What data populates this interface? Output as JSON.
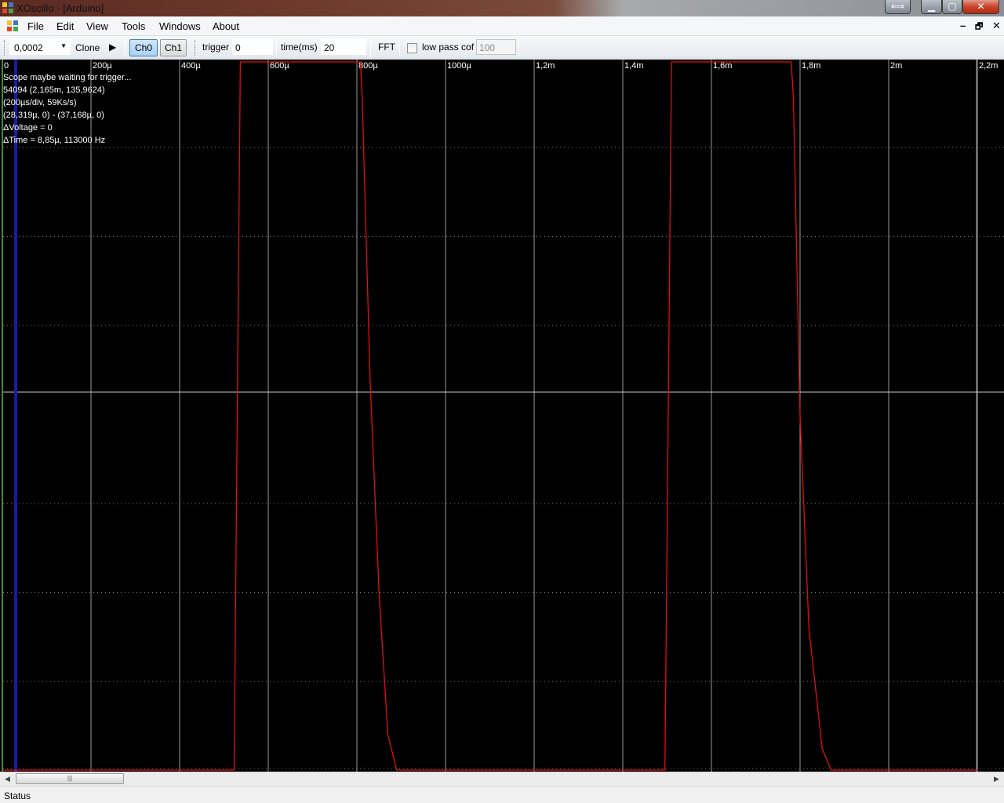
{
  "window": {
    "title": "XOscillo - [Arduino]",
    "close_glyph": "✕",
    "min_glyph": "▁",
    "max_glyph": "▢",
    "swap_glyph": "⟺"
  },
  "menu": {
    "items": [
      {
        "label": "File"
      },
      {
        "label": "Edit"
      },
      {
        "label": "View"
      },
      {
        "label": "Tools"
      },
      {
        "label": "Windows"
      },
      {
        "label": "About"
      }
    ],
    "mdi_min": "–",
    "mdi_restore": "🗗",
    "mdi_close": "✕"
  },
  "toolbar": {
    "time_scale_value": "0,0002",
    "clone_label": "Clone",
    "play_glyph": "▶",
    "ch0_label": "Ch0",
    "ch1_label": "Ch1",
    "trigger_label": "trigger",
    "trigger_value": "0",
    "time_ms_label": "time(ms)",
    "time_ms_value": "20",
    "fft_label": "FFT",
    "low_pass_label": "low pass cof",
    "low_pass_value": "100",
    "low_pass_checked": false
  },
  "scope": {
    "info": [
      "Scope maybe waiting for trigger...",
      "54094 (2,165m, 135,9624)",
      "(200µs/div, 59Ks/s)",
      "(28,319µ, 0) - (37,168µ, 0)",
      "ΔVoltage = 0",
      "ΔTime = 8,85µ, 113000 Hz"
    ],
    "time_ticks": [
      "0",
      "200µ",
      "400µ",
      "600µ",
      "800µ",
      "1000µ",
      "1,2m",
      "1,4m",
      "1,6m",
      "1,8m",
      "2m",
      "2,2m"
    ],
    "colors": {
      "trace": "#e01010",
      "grid": "#9a9a9a",
      "cursor": "#1a1aa8",
      "background": "#000000"
    }
  },
  "chart_data": {
    "type": "line",
    "x_unit": "s",
    "xlim": [
      0,
      0.0022
    ],
    "ylim": [
      0,
      1
    ],
    "series": [
      {
        "x": [
          0,
          0.000523,
          0.000537,
          0.000808,
          0.000812,
          0.00083,
          0.00085,
          0.00087,
          0.00089,
          0.001495,
          0.00151,
          0.00178,
          0.001785,
          0.0018,
          0.00182,
          0.00185,
          0.00187,
          0.0022
        ],
        "y": [
          0,
          0,
          1,
          1,
          0.95,
          0.55,
          0.25,
          0.05,
          0,
          0,
          1,
          1,
          0.95,
          0.5,
          0.2,
          0.03,
          0,
          0
        ]
      }
    ],
    "grid": true
  },
  "status": {
    "label": "Status"
  },
  "scrollbar": {
    "left_arrow": "◀",
    "right_arrow": "▶",
    "thumb_grip": "|||"
  }
}
